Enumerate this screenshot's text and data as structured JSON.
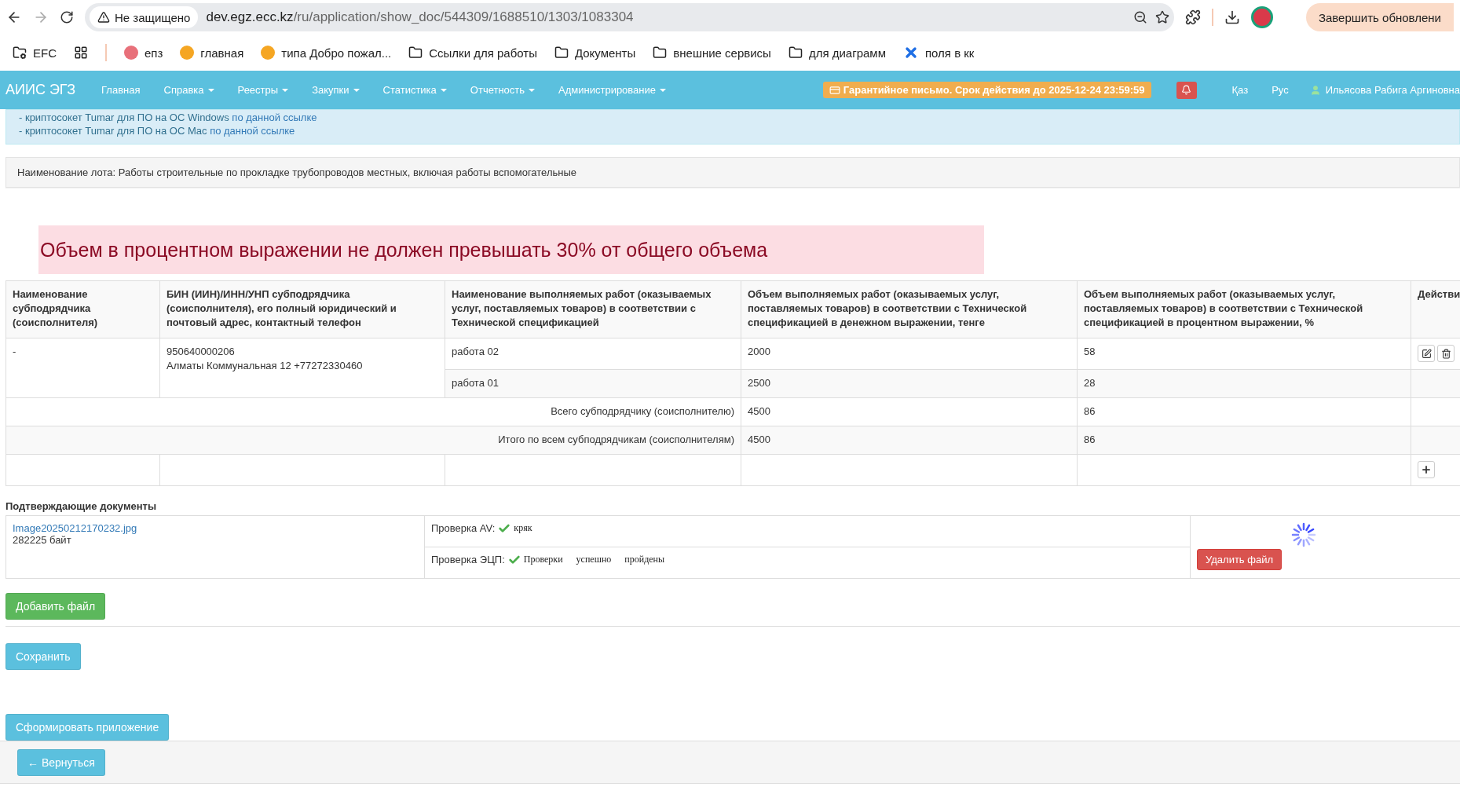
{
  "browser": {
    "security": "Не защищено",
    "url_host": "dev.egz.ecc.kz",
    "url_path": "/ru/application/show_doc/544309/1688510/1303/1083304",
    "update_button": "Завершить обновлени"
  },
  "bookmarks": [
    {
      "kind": "gear-folder",
      "label": "EFC"
    },
    {
      "kind": "apps"
    },
    {
      "kind": "site",
      "label": "епз"
    },
    {
      "kind": "sun",
      "label": "главная"
    },
    {
      "kind": "sun",
      "label": "типа Добро пожал..."
    },
    {
      "kind": "folder",
      "label": "Ссылки для работы"
    },
    {
      "kind": "folder",
      "label": "Документы"
    },
    {
      "kind": "folder",
      "label": "внешние сервисы"
    },
    {
      "kind": "folder",
      "label": "для диаграмм"
    },
    {
      "kind": "cross",
      "label": "поля в кк"
    }
  ],
  "navbar": {
    "brand": "АИИС ЭГЗ",
    "menu": [
      {
        "label": "Главная",
        "dropdown": false
      },
      {
        "label": "Справка",
        "dropdown": true
      },
      {
        "label": "Реестры",
        "dropdown": true
      },
      {
        "label": "Закупки",
        "dropdown": true
      },
      {
        "label": "Статистика",
        "dropdown": true
      },
      {
        "label": "Отчетность",
        "dropdown": true
      },
      {
        "label": "Администрирование",
        "dropdown": true
      }
    ],
    "guarantee": "Гарантийное письмо. Срок действия до 2025-12-24 23:59:59",
    "languages": [
      "Қаз",
      "Рус"
    ],
    "user": "Ильясова Рабига Аргиновна"
  },
  "info_banner": [
    {
      "text": "- криптосокет Tumar для ПО на ОС Windows ",
      "link": "по данной ссылке"
    },
    {
      "text": "- криптосокет Tumar для ПО на ОС Mac ",
      "link": "по данной ссылке"
    }
  ],
  "lot": "Наименование лота: Работы строительные по прокладке трубопроводов местных, включая работы вспомогательные",
  "alert": "Объем в процентном выражении не должен превышать 30% от общего объема",
  "table": {
    "columns": [
      "Наименование субподрядчика (соисполнителя)",
      "БИН (ИИН)/ИНН/УНП субподрядчика (соисполнителя), его полный юридический и почтовый адрес, контактный телефон",
      "Наименование выполняемых работ (оказываемых услуг, поставляемых товаров) в соответствии с Технической спецификацией",
      "Объем выполняемых работ (оказываемых услуг, поставляемых товаров) в соответствии с Технической спецификацией в денежном выражении, тенге",
      "Объем выполняемых работ (оказываемых услуг, поставляемых товаров) в соответствии с Технической спецификацией в процентном выражении, %",
      "Действи"
    ],
    "subcontractors": [
      {
        "name": "-",
        "bin": "950640000206",
        "address": "Алматы Коммунальная 12 +77272330460",
        "works": [
          {
            "name": "работа 02",
            "amount": "2000",
            "percent": "58"
          },
          {
            "name": "работа 01",
            "amount": "2500",
            "percent": "28"
          }
        ]
      }
    ],
    "totals": [
      {
        "label": "Всего субподрядчику (соисполнителю)",
        "amount": "4500",
        "percent": "86"
      },
      {
        "label": "Итого по всем субподрядчикам (соисполнителям)",
        "amount": "4500",
        "percent": "86"
      }
    ]
  },
  "documents": {
    "title": "Подтверждающие документы",
    "files": [
      {
        "name": "Image20250212170232.jpg",
        "size": "282225 байт",
        "checks": [
          {
            "label": "Проверка AV:",
            "ok": true,
            "result": "кряк"
          },
          {
            "label": "Проверка ЭЦП:",
            "ok": true,
            "result": "Проверки успешно пройдены"
          }
        ],
        "loading": true,
        "delete": "Удалить файл"
      }
    ],
    "add_file": "Добавить файл"
  },
  "save": "Сохранить",
  "generate": "Сформировать приложение",
  "back": "← Вернуться"
}
